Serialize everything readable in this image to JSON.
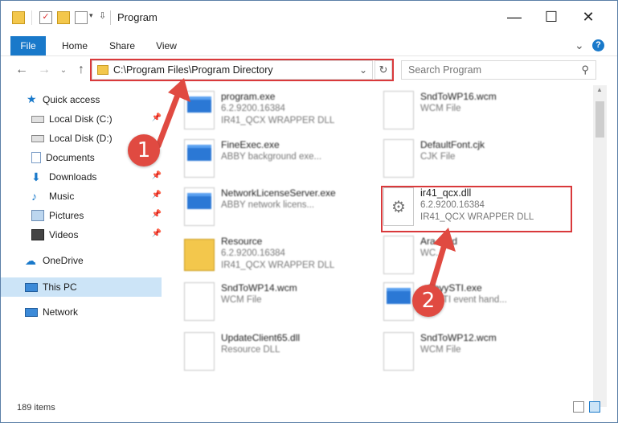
{
  "titlebar": {
    "title": "Program",
    "minimize": "—",
    "maximize": "☐",
    "close": "✕"
  },
  "ribbon": {
    "tabs": [
      "File",
      "Home",
      "Share",
      "View"
    ],
    "help": "?",
    "expand": "⌄"
  },
  "address": {
    "path": "C:\\Program Files\\Program Directory"
  },
  "search": {
    "placeholder": "Search Program"
  },
  "sidebar": {
    "items": [
      {
        "label": "Quick access",
        "icon": "star-icon"
      },
      {
        "label": "Local Disk (C:)",
        "icon": "drive-icon"
      },
      {
        "label": "Local Disk (D:)",
        "icon": "drive-icon"
      },
      {
        "label": "Documents",
        "icon": "documents-icon"
      },
      {
        "label": "Downloads",
        "icon": "downloads-icon"
      },
      {
        "label": "Music",
        "icon": "music-icon"
      },
      {
        "label": "Pictures",
        "icon": "pictures-icon"
      },
      {
        "label": "Videos",
        "icon": "videos-icon"
      },
      {
        "label": "OneDrive",
        "icon": "cloud-icon"
      },
      {
        "label": "This PC",
        "icon": "computer-icon"
      },
      {
        "label": "Network",
        "icon": "network-icon"
      }
    ]
  },
  "files": [
    {
      "name": "program.exe",
      "meta1": "6.2.9200.16384",
      "meta2": "IR41_QCX WRAPPER DLL"
    },
    {
      "name": "FineExec.exe",
      "meta1": "ABBY background exe...",
      "meta2": ""
    },
    {
      "name": "NetworkLicenseServer.exe",
      "meta1": "ABBY network licens...",
      "meta2": ""
    },
    {
      "name": "Resource",
      "meta1": "6.2.9200.16384",
      "meta2": "IR41_QCX WRAPPER DLL"
    },
    {
      "name": "SndToWP14.wcm",
      "meta1": "WCM File",
      "meta2": ""
    },
    {
      "name": "UpdateClient65.dll",
      "meta1": "Resource DLL",
      "meta2": ""
    },
    {
      "name": "SndToWP16.wcm",
      "meta1": "WCM File",
      "meta2": ""
    },
    {
      "name": "DefaultFont.cjk",
      "meta1": "CJK File",
      "meta2": ""
    },
    {
      "name": "ir41_qcx.dll",
      "meta1": "6.2.9200.16384",
      "meta2": "IR41_QCX WRAPPER DLL"
    },
    {
      "name": "Ara...ord",
      "meta1": "WC...",
      "meta2": ""
    },
    {
      "name": "...bbyySTI.exe",
      "meta1": "...Y STI event hand...",
      "meta2": ""
    },
    {
      "name": "SndToWP12.wcm",
      "meta1": "WCM File",
      "meta2": ""
    }
  ],
  "status": {
    "count": "189 items"
  },
  "annotations": {
    "step1": "1",
    "step2": "2"
  },
  "colors": {
    "accent": "#1979ca",
    "highlight_red": "#d9393b",
    "badge_red": "#e04a41"
  }
}
